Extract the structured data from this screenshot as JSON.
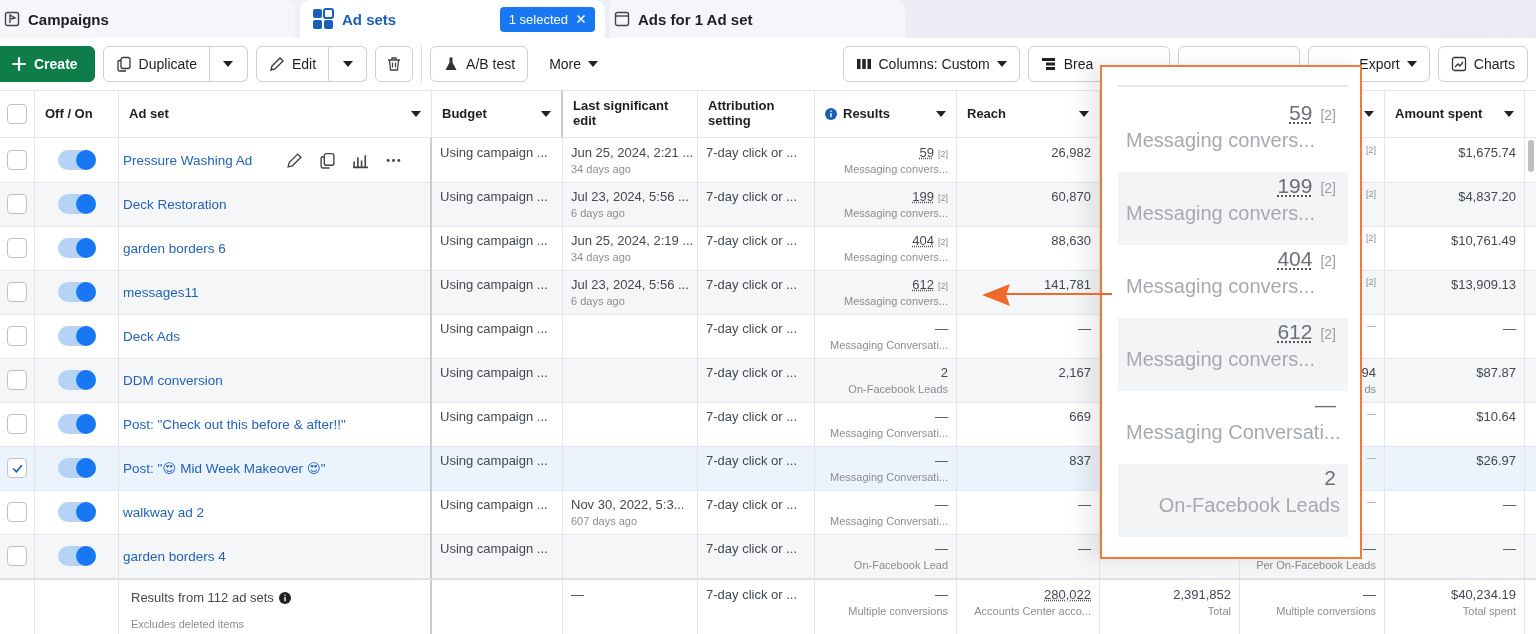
{
  "tabs": [
    {
      "label": "Campaigns",
      "selected": false,
      "kind": "campaigns"
    },
    {
      "label": "Ad sets",
      "selected": true,
      "kind": "adsets",
      "badge": "1 selected"
    },
    {
      "label": "Ads for 1 Ad set",
      "selected": false,
      "kind": "ads"
    }
  ],
  "toolbar": {
    "create": "Create",
    "duplicate": "Duplicate",
    "edit": "Edit",
    "ab_test": "A/B test",
    "more": "More",
    "columns": "Columns: Custom",
    "breakdown": "Brea",
    "export": "Export",
    "charts": "Charts"
  },
  "header": {
    "checked": false,
    "columns": [
      {
        "label": "Off / On",
        "menu": false
      },
      {
        "label": "Ad set",
        "menu": true
      },
      {
        "label": "Budget",
        "menu": true
      },
      {
        "label": "Last significant edit",
        "menu": false
      },
      {
        "label": "Attribution setting",
        "menu": false
      },
      {
        "label": "Results",
        "menu": true,
        "info": true
      },
      {
        "label": "Reach",
        "menu": true
      },
      {
        "menu": true
      },
      {
        "label": "Amount spent",
        "menu": true
      }
    ]
  },
  "rows": [
    {
      "selected": false,
      "on": true,
      "name": "Pressure Washing Ad",
      "show_actions": true,
      "budget": "Using campaign ...",
      "edit": "Jun 25, 2024, 2:21 ...",
      "edit_ago": "34 days ago",
      "attribution": "7-day click or ...",
      "result": "59",
      "note": "[2]",
      "result_type": "Messaging convers...",
      "reach": "26,982",
      "col_10": "[2]",
      "spent": "$1,675.74"
    },
    {
      "selected": false,
      "on": true,
      "name": "Deck Restoration",
      "show_actions": false,
      "budget": "Using campaign ...",
      "edit": "Jul 23, 2024, 5:56 ...",
      "edit_ago": "6 days ago",
      "attribution": "7-day click or ...",
      "result": "199",
      "note": "[2]",
      "result_type": "Messaging convers...",
      "reach": "60,870",
      "col_10": "[2]",
      "spent": "$4,837.20"
    },
    {
      "selected": false,
      "on": true,
      "name": "garden borders 6",
      "show_actions": false,
      "budget": "Using campaign ...",
      "edit": "Jun 25, 2024, 2:19 ...",
      "edit_ago": "34 days ago",
      "attribution": "7-day click or ...",
      "result": "404",
      "note": "[2]",
      "result_type": "Messaging convers...",
      "reach": "88,630",
      "col_10": "[2]",
      "spent": "$10,761.49"
    },
    {
      "selected": false,
      "on": true,
      "name": "messages11",
      "show_actions": false,
      "budget": "Using campaign ...",
      "edit": "Jul 23, 2024, 5:56 ...",
      "edit_ago": "6 days ago",
      "attribution": "7-day click or ...",
      "result": "612",
      "note": "[2]",
      "result_type": "Messaging convers...",
      "reach": "141,781",
      "col_10": "[2]",
      "spent": "$13,909.13"
    },
    {
      "selected": false,
      "on": true,
      "name": "Deck Ads",
      "show_actions": false,
      "budget": "Using campaign ...",
      "attribution": "7-day click or ...",
      "result": "—",
      "result_type": "Messaging Conversati...",
      "reach": "—",
      "col_10": "—",
      "spent": "—"
    },
    {
      "selected": false,
      "on": true,
      "name": "DDM conversion",
      "show_actions": false,
      "budget": "Using campaign ...",
      "attribution": "7-day click or ...",
      "result": "2",
      "result_type": "On-Facebook Leads",
      "reach": "2,167",
      "col_10": "94",
      "col_10_sub": "ds",
      "spent": "$87.87"
    },
    {
      "selected": false,
      "on": true,
      "name": "Post: \"Check out this before & after!!\"",
      "show_actions": false,
      "budget": "Using campaign ...",
      "attribution": "7-day click or ...",
      "result": "—",
      "result_type": "Messaging Conversati...",
      "reach": "669",
      "col_10": "—",
      "spent": "$10.64"
    },
    {
      "selected": true,
      "on": true,
      "name": "Post: \"😍 Mid Week Makeover 😍\"",
      "show_actions": false,
      "budget": "Using campaign ...",
      "attribution": "7-day click or ...",
      "result": "—",
      "result_type": "Messaging Conversati...",
      "reach": "837",
      "col_10": "—",
      "spent": "$26.97"
    },
    {
      "selected": false,
      "on": true,
      "name": "walkway ad 2",
      "show_actions": false,
      "budget": "Using campaign ...",
      "edit": "Nov 30, 2022, 5:3...",
      "edit_ago": "607 days ago",
      "attribution": "7-day click or ...",
      "result": "—",
      "result_type": "Messaging Conversati...",
      "reach": "—",
      "col_10": "—",
      "spent": "—"
    },
    {
      "selected": false,
      "on": true,
      "name": "garden borders 4",
      "show_actions": false,
      "budget": "Using campaign ...",
      "attribution": "7-day click or ...",
      "result": "—",
      "result_type": "On-Facebook Lead",
      "reach": "—",
      "col_10": "—",
      "col_10_sub": "Per On-Facebook Leads",
      "spent": "—"
    }
  ],
  "footer": {
    "title": "Results from 112 ad sets",
    "subtitle": "Excludes deleted items",
    "edit": "—",
    "attribution": "7-day click or ...",
    "result": "—",
    "result_type": "Multiple conversions",
    "reach": "280,022",
    "reach_sub": "Accounts Center acco...",
    "col_9": "2,391,852",
    "col_9_sub": "Total",
    "col_10": "—",
    "col_10_sub": "Multiple conversions",
    "spent": "$40,234.19",
    "spent_sub": "Total spent"
  },
  "callout": {
    "items": [
      {
        "value": "59",
        "note": "[2]",
        "label": "Messaging convers..."
      },
      {
        "value": "199",
        "note": "[2]",
        "label": "Messaging convers..."
      },
      {
        "value": "404",
        "note": "[2]",
        "label": "Messaging convers..."
      },
      {
        "value": "612",
        "note": "[2]",
        "label": "Messaging convers..."
      },
      {
        "value": "—",
        "label": "Messaging Conversati..."
      },
      {
        "value": "2",
        "label": "On-Facebook Leads"
      }
    ]
  }
}
